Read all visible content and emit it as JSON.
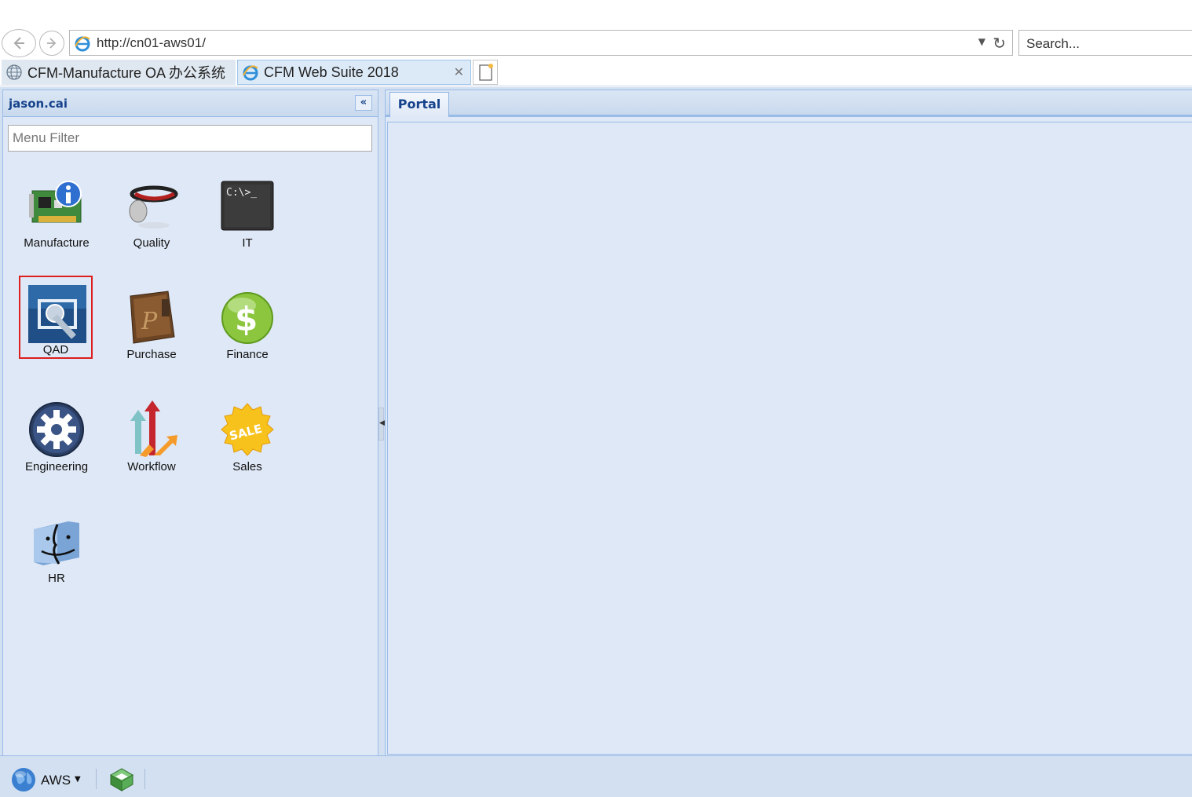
{
  "browser": {
    "url": "http://cn01-aws01/",
    "search_placeholder": "Search...",
    "tabs": [
      {
        "title": "CFM-Manufacture OA 办公系统",
        "active": false
      },
      {
        "title": "CFM Web Suite 2018",
        "active": true
      }
    ]
  },
  "left_panel": {
    "user": "jason.cai",
    "filter_placeholder": "Menu Filter",
    "modules": [
      {
        "label": "Manufacture",
        "icon": "network-card-info-icon"
      },
      {
        "label": "Quality",
        "icon": "stopwatch-collar-icon"
      },
      {
        "label": "IT",
        "icon": "command-prompt-icon"
      },
      {
        "label": "QAD",
        "icon": "qad-joystick-icon",
        "selected": true
      },
      {
        "label": "Purchase",
        "icon": "leather-book-icon"
      },
      {
        "label": "Finance",
        "icon": "dollar-coin-icon"
      },
      {
        "label": "Engineering",
        "icon": "gear-icon"
      },
      {
        "label": "Workflow",
        "icon": "workflow-arrows-icon"
      },
      {
        "label": "Sales",
        "icon": "sale-badge-icon"
      },
      {
        "label": "HR",
        "icon": "finder-face-icon"
      }
    ]
  },
  "main": {
    "tabs": [
      {
        "label": "Portal"
      }
    ]
  },
  "bottom_bar": {
    "server_label": "AWS"
  },
  "colors": {
    "panel_bg": "#dfe8f6",
    "panel_border": "#99bbe8",
    "title_text": "#15428b",
    "selected_border": "#dd1f1f"
  }
}
